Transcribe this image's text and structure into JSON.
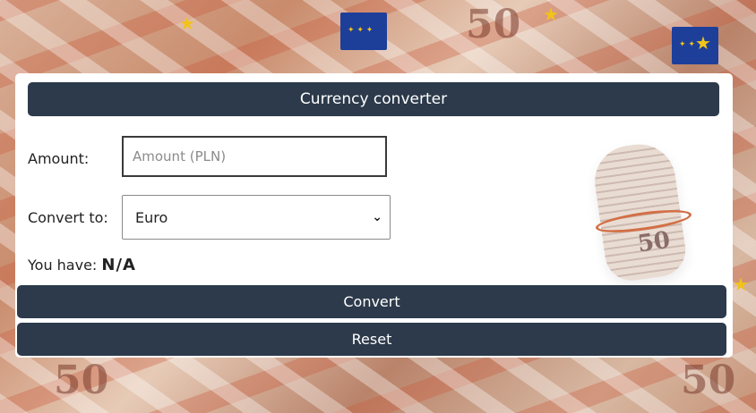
{
  "app": {
    "title": "Currency converter"
  },
  "form": {
    "amount_label": "Amount:",
    "amount_placeholder": "Amount (PLN)",
    "amount_value": "",
    "convert_to_label": "Convert to:",
    "convert_to_selected": "Euro",
    "result_label": "You have:",
    "result_value": "N/A"
  },
  "actions": {
    "convert_label": "Convert",
    "reset_label": "Reset"
  },
  "background": {
    "icons": [
      "eu-flag-icon",
      "star-icon"
    ],
    "note_text": "50"
  },
  "colors": {
    "accent": "#2c3a4b",
    "card": "#ffffff"
  }
}
